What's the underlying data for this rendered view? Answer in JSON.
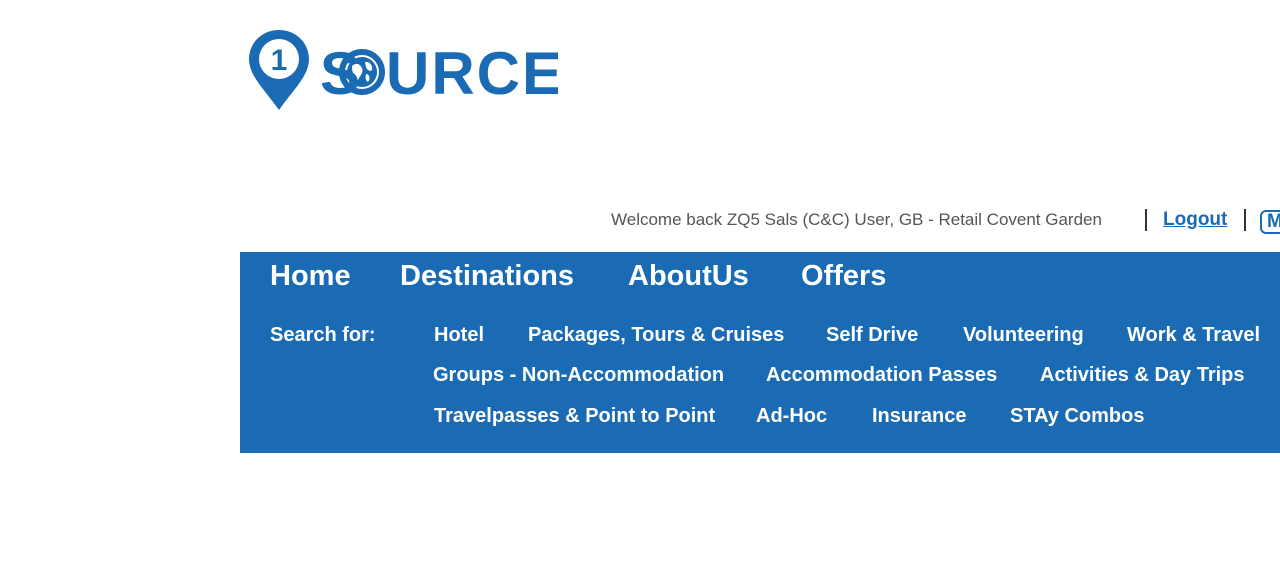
{
  "logo": {
    "text": "SOURCE",
    "badge_number": "1",
    "brand_color": "#1a6bb3"
  },
  "header": {
    "welcome_text": "Welcome back ZQ5 Sals (C&C) User, GB - Retail Covent Garden",
    "logout_label": "Logout",
    "my_button_label": "M"
  },
  "main_nav": {
    "items": [
      {
        "label": "Home"
      },
      {
        "label": "Destinations"
      },
      {
        "label": "AboutUs"
      },
      {
        "label": "Offers"
      }
    ]
  },
  "search": {
    "label": "Search for:",
    "items": [
      {
        "label": "Hotel"
      },
      {
        "label": "Packages, Tours & Cruises"
      },
      {
        "label": "Self Drive"
      },
      {
        "label": "Volunteering"
      },
      {
        "label": "Work & Travel"
      },
      {
        "label": "Groups - Non-Accommodation"
      },
      {
        "label": "Accommodation Passes"
      },
      {
        "label": "Activities & Day Trips"
      },
      {
        "label": "Travelpasses & Point to Point"
      },
      {
        "label": "Ad-Hoc"
      },
      {
        "label": "Insurance"
      },
      {
        "label": "STAy Combos"
      }
    ]
  },
  "colors": {
    "nav_background": "#1a6bb3",
    "nav_text": "#ffffff",
    "welcome_text": "#555555"
  }
}
